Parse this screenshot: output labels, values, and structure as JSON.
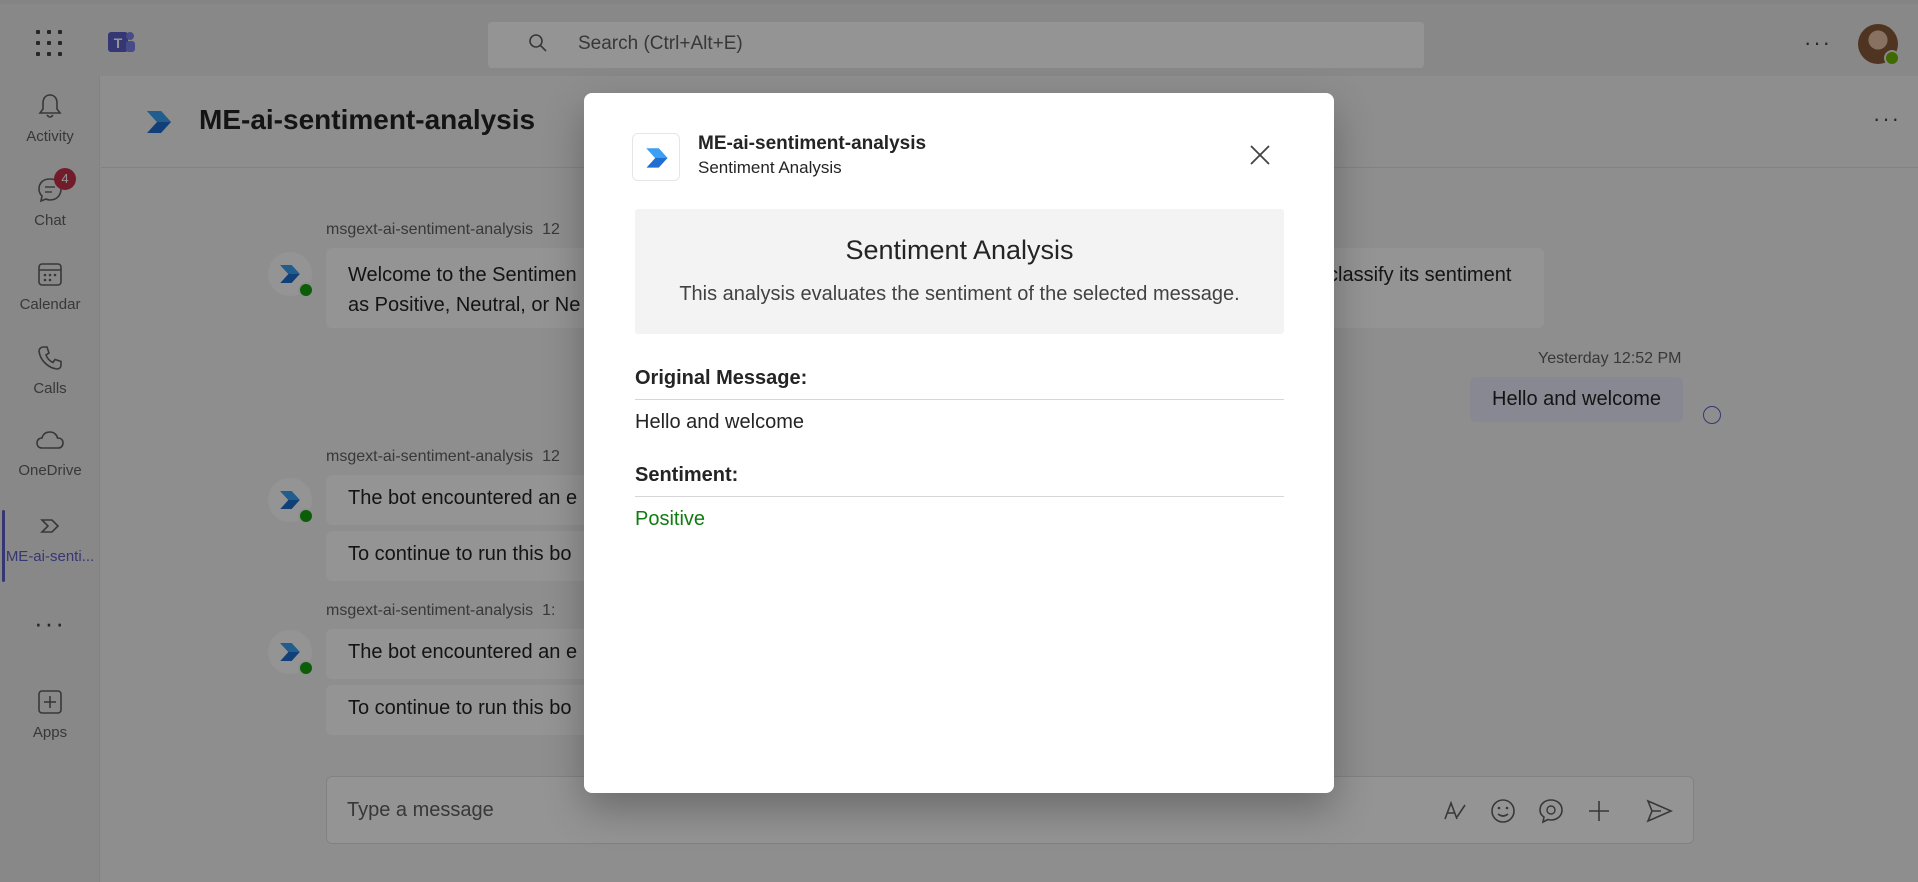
{
  "topbar": {
    "search_placeholder": "Search (Ctrl+Alt+E)"
  },
  "rail": {
    "items": [
      {
        "label": "Activity"
      },
      {
        "label": "Chat",
        "badge": "4"
      },
      {
        "label": "Calendar"
      },
      {
        "label": "Calls"
      },
      {
        "label": "OneDrive"
      },
      {
        "label": "ME-ai-senti..."
      },
      {
        "label": "Apps"
      }
    ]
  },
  "channel": {
    "title": "ME-ai-sentiment-analysis"
  },
  "messages": [
    {
      "sender": "msgext-ai-sentiment-analysis",
      "time_fragment": "12",
      "lines": [
        "Welcome to the Sentimen",
        "as Positive, Neutral, or Ne"
      ],
      "right_fragment": "classify its sentiment"
    },
    {
      "sender": "msgext-ai-sentiment-analysis",
      "time_fragment": "12",
      "lines": [
        "The bot encountered an e",
        "To continue to run this bo"
      ]
    },
    {
      "sender": "msgext-ai-sentiment-analysis",
      "time_fragment": "1:",
      "lines": [
        "The bot encountered an e",
        "To continue to run this bo"
      ]
    }
  ],
  "my_message": {
    "time": "Yesterday 12:52 PM",
    "text": "Hello and welcome"
  },
  "composer": {
    "placeholder": "Type a message"
  },
  "dialog": {
    "app_name": "ME-ai-sentiment-analysis",
    "app_subtitle": "Sentiment Analysis",
    "card": {
      "heading": "Sentiment Analysis",
      "description": "This analysis evaluates the sentiment of the selected message."
    },
    "original_label": "Original Message:",
    "original_value": "Hello and welcome",
    "sentiment_label": "Sentiment:",
    "sentiment_value": "Positive"
  },
  "colors": {
    "accent": "#5b5fc7",
    "positive": "#107c10",
    "badge": "#c4314b"
  }
}
